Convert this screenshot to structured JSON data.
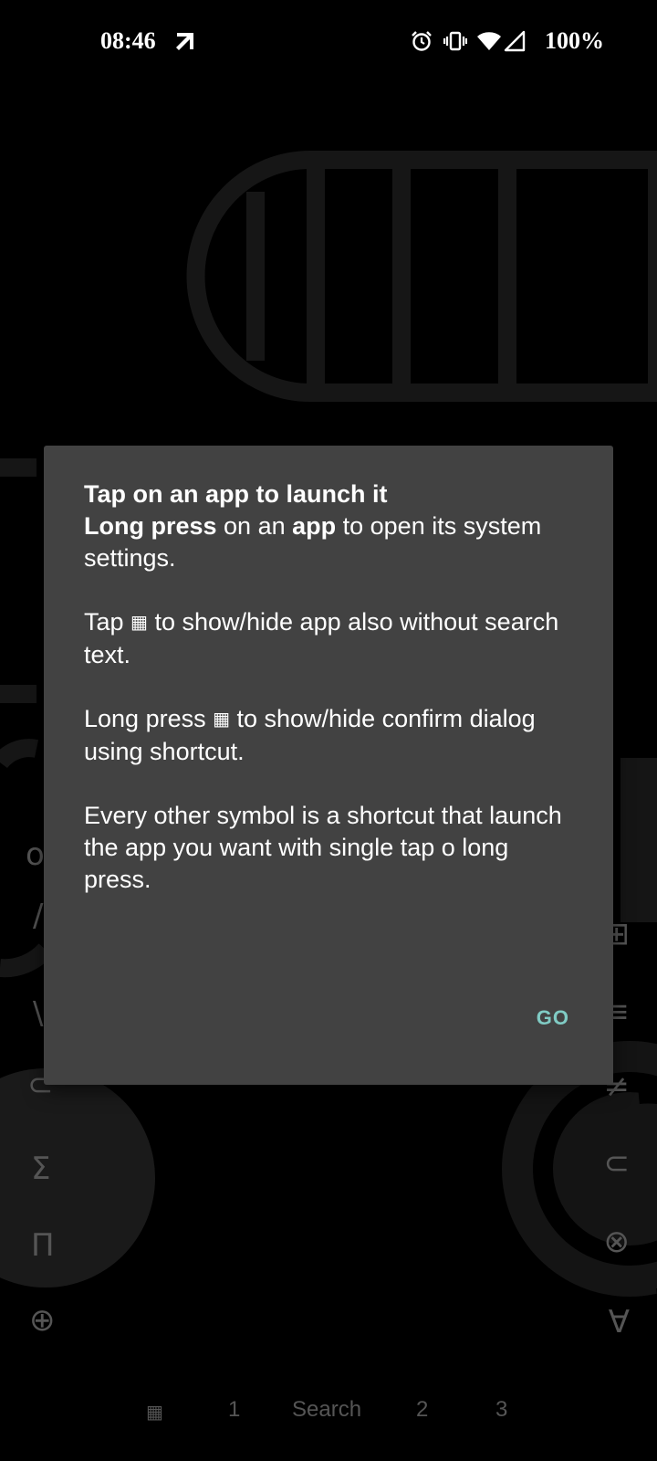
{
  "status_bar": {
    "time": "08:46",
    "battery": "100%"
  },
  "dialog": {
    "line1": "Tap on an app to launch it",
    "line2_bold_a": "Long press",
    "line2_mid": " on an ",
    "line2_bold_b": "app",
    "line2_end": " to open its system settings.",
    "para2_start": "Tap ",
    "para2_icon": "▦",
    "para2_end": " to show/hide app also without search text.",
    "para3_start": "Long press ",
    "para3_icon": "▦",
    "para3_end": " to show/hide confirm dialog using shortcut.",
    "para4": "Every other symbol is a shortcut that launch the app you want with single tap o long press.",
    "go_label": "GO"
  },
  "left_symbols": [
    "o",
    "/",
    "\\",
    "⊂",
    "Σ",
    "Π",
    "⊕"
  ],
  "right_symbols": [
    "{",
    "⊞",
    "≡",
    "≠",
    "⊂",
    "⊗",
    "∀"
  ],
  "bottom_bar": {
    "grid_icon": "▦",
    "item1": "1",
    "search": "Search",
    "item2": "2",
    "item3": "3"
  }
}
